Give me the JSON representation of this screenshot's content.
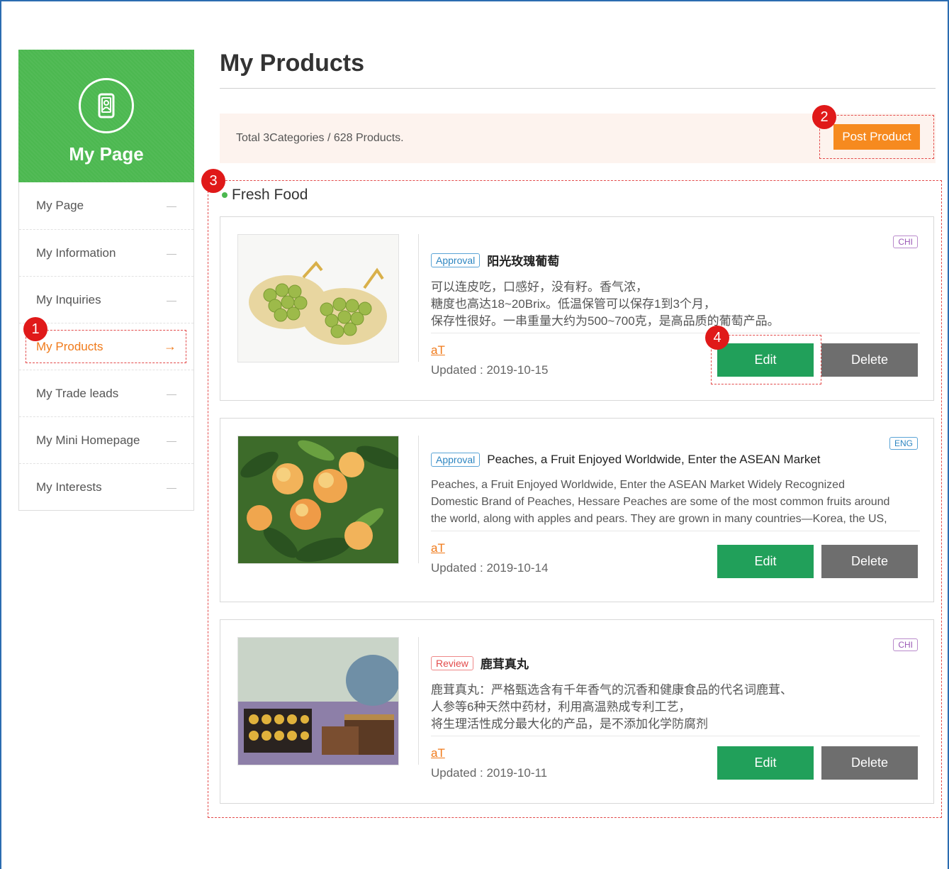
{
  "sidebar": {
    "title": "My Page",
    "items": [
      {
        "label": "My Page"
      },
      {
        "label": "My Information"
      },
      {
        "label": "My Inquiries"
      },
      {
        "label": "My Products"
      },
      {
        "label": "My Trade leads"
      },
      {
        "label": "My Mini Homepage"
      },
      {
        "label": "My Interests"
      }
    ],
    "active_index": 3
  },
  "main": {
    "title": "My Products",
    "summary": "Total 3Categories / 628 Products.",
    "post_label": "Post Product",
    "category": "Fresh Food",
    "products": [
      {
        "status": "Approval",
        "lang": "CHI",
        "title": "阳光玫瑰葡萄",
        "desc": [
          "可以连皮吃，口感好，没有籽。香气浓，",
          "糖度也高达18~20Brix。低温保管可以保存1到3个月，",
          "保存性很好。一串重量大约为500~700克，是高品质的葡萄产品。"
        ],
        "company": "aT",
        "updated": "Updated : 2019-10-15",
        "edit": "Edit",
        "delete": "Delete"
      },
      {
        "status": "Approval",
        "lang": "ENG",
        "title": "Peaches, a Fruit Enjoyed Worldwide, Enter the ASEAN Market",
        "desc": [
          "Peaches, a Fruit Enjoyed Worldwide, Enter the ASEAN Market Widely Recognized",
          "Domestic Brand of Peaches, Hessare Peaches are some of the most common fruits around",
          "the world, along with apples and pears. They are grown in many countries—Korea, the US,"
        ],
        "company": "aT",
        "updated": "Updated : 2019-10-14",
        "edit": "Edit",
        "delete": "Delete"
      },
      {
        "status": "Review",
        "lang": "CHI",
        "title": "鹿茸真丸",
        "desc": [
          "鹿茸真丸：严格甄选含有千年香气的沉香和健康食品的代名词鹿茸、",
          "人参等6种天然中药材，利用高温熟成专利工艺，",
          "将生理活性成分最大化的产品，是不添加化学防腐剂"
        ],
        "company": "aT",
        "updated": "Updated : 2019-10-11",
        "edit": "Edit",
        "delete": "Delete"
      }
    ]
  },
  "markers": [
    "1",
    "2",
    "3",
    "4"
  ],
  "colors": {
    "brand_green": "#4cb850",
    "accent_orange": "#f68a1f",
    "edit_green": "#21a05a",
    "delete_gray": "#6e6e6e",
    "marker_red": "#e01919"
  }
}
